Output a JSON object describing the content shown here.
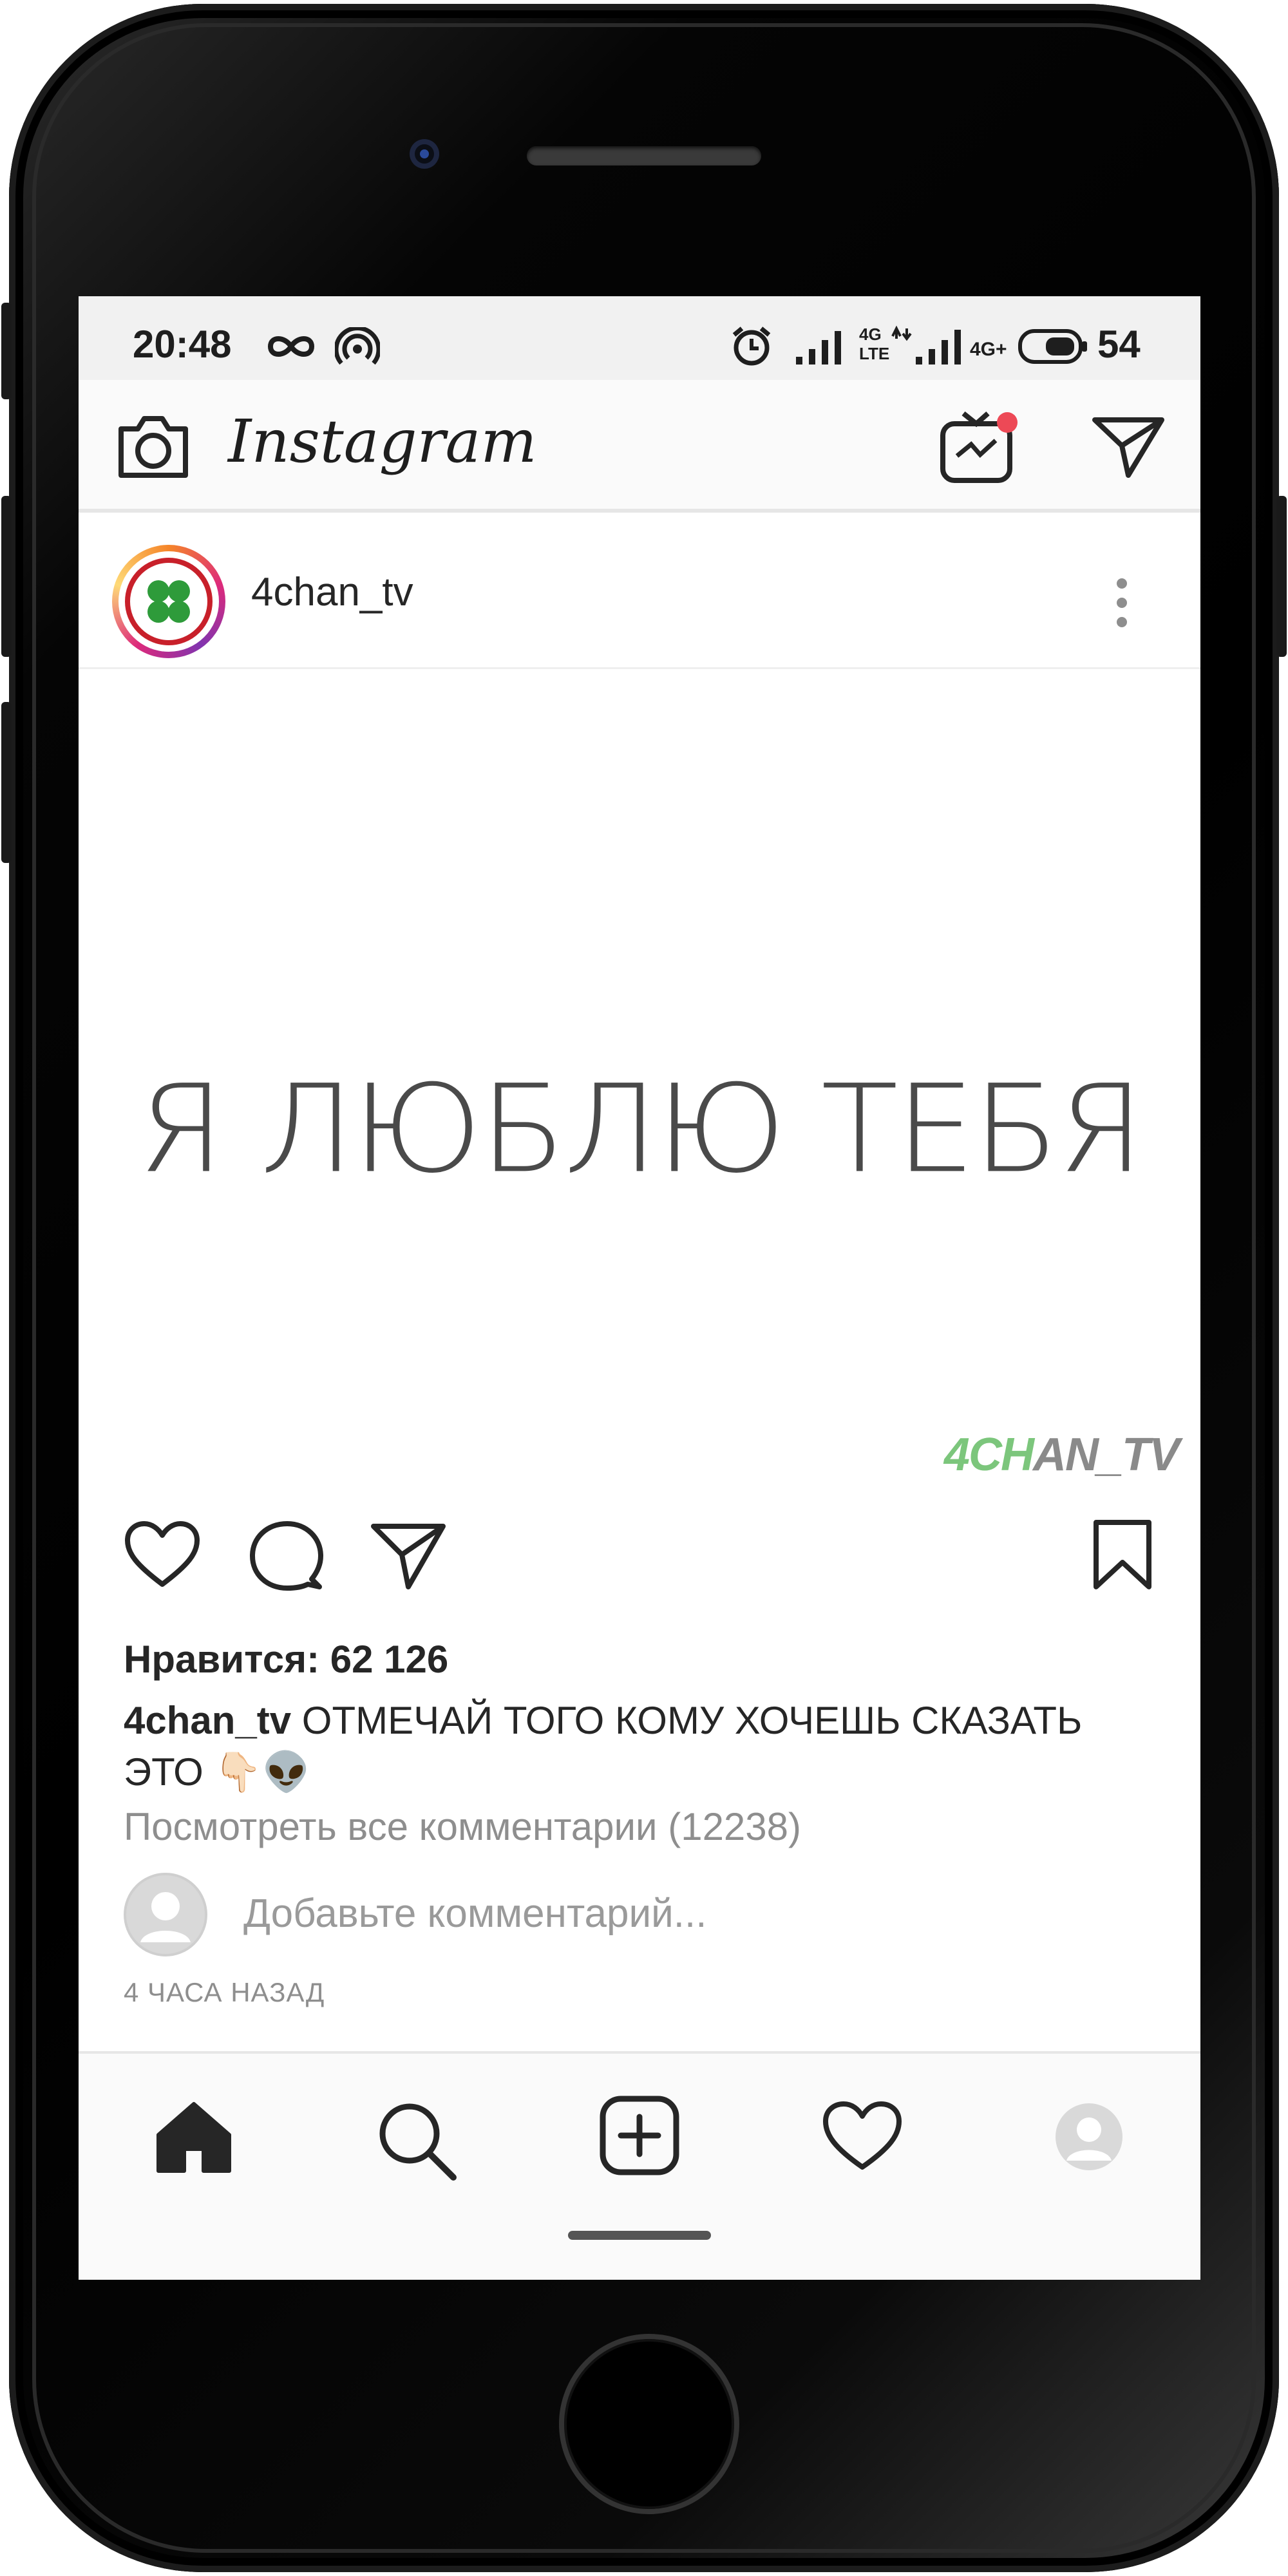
{
  "status_bar": {
    "time": "20:48",
    "network_label_1": "4G",
    "network_label_2": "LTE",
    "network_label_3": "4G+",
    "battery": "54"
  },
  "top_bar": {
    "app_logo": "Instagram",
    "icons": [
      "camera-icon",
      "igtv-icon",
      "direct-message-icon"
    ],
    "notification_color": "#ed4956"
  },
  "post": {
    "username": "4chan_tv",
    "image_text": "Я ЛЮБЛЮ ТЕБЯ",
    "watermark": {
      "green_part": "4CH",
      "gray_part": "AN_TV",
      "green_color": "#7cc67c",
      "gray_color": "#8a8a8a"
    },
    "likes": "Нравится: 62 126",
    "caption_user": "4chan_tv",
    "caption_text": " ОТМЕЧАЙ ТОГО КОМУ ХОЧЕШЬ СКАЗАТЬ ЭТО ",
    "caption_emoji": "👇🏻👽",
    "view_comments": "Посмотреть все комментарии (12238)",
    "add_comment_placeholder": "Добавьте комментарий...",
    "timestamp": "4 ЧАСА НАЗАД"
  },
  "bottom_nav": {
    "icons": [
      "home-icon",
      "search-icon",
      "add-post-icon",
      "activity-heart-icon",
      "profile-avatar-icon"
    ]
  }
}
